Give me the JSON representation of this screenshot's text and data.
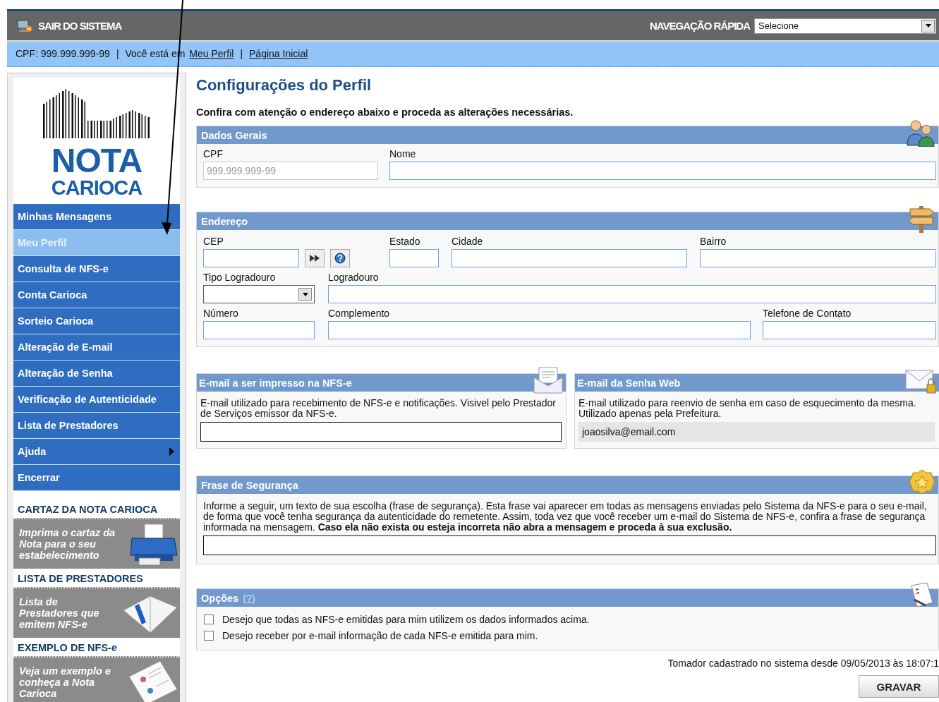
{
  "header": {
    "exit_label": "SAIR DO SISTEMA",
    "quick_nav_label": "NAVEGAÇÃO RÁPIDA",
    "quick_nav_value": "Selecione"
  },
  "breadcrumb": {
    "cpf": "CPF: 999.999.999-99",
    "separator": "|",
    "location_label": "Você está em",
    "links": [
      "Meu Perfil",
      "Página Inicial"
    ]
  },
  "sidebar": {
    "logo": {
      "top": "NOTA",
      "bottom": "CARIOCA"
    },
    "menu": [
      {
        "label": "Minhas Mensagens",
        "selected": false,
        "has_submenu": false
      },
      {
        "label": "Meu Perfil",
        "selected": true,
        "has_submenu": false
      },
      {
        "label": "Consulta de NFS-e",
        "selected": false,
        "has_submenu": false
      },
      {
        "label": "Conta Carioca",
        "selected": false,
        "has_submenu": false
      },
      {
        "label": "Sorteio Carioca",
        "selected": false,
        "has_submenu": false
      },
      {
        "label": "Alteração de E-mail",
        "selected": false,
        "has_submenu": false
      },
      {
        "label": "Alteração de Senha",
        "selected": false,
        "has_submenu": false
      },
      {
        "label": "Verificação de Autenticidade",
        "selected": false,
        "has_submenu": false
      },
      {
        "label": "Lista de Prestadores",
        "selected": false,
        "has_submenu": false
      },
      {
        "label": "Ajuda",
        "selected": false,
        "has_submenu": true
      },
      {
        "label": "Encerrar",
        "selected": false,
        "has_submenu": false
      }
    ],
    "promos": [
      {
        "kind": "printer",
        "title": "CARTAZ DA NOTA CARIOCA",
        "text": "Imprima o cartaz da Nota para o seu estabelecimento"
      },
      {
        "kind": "book",
        "title": "LISTA DE PRESTADORES",
        "text": "Lista de Prestadores que emitem NFS-e"
      },
      {
        "kind": "document",
        "title": "EXEMPLO DE NFS-e",
        "text": "Veja um exemplo e conheça a Nota Carioca"
      }
    ]
  },
  "main": {
    "title": "Configurações do Perfil",
    "intro": "Confira com atenção o endereço abaixo e proceda as alterações necessárias.",
    "dados_gerais": {
      "title": "Dados Gerais",
      "fields": [
        {
          "label": "CPF",
          "value": "999.999.999-99",
          "disabled": true
        },
        {
          "label": "Nome",
          "disabled": false
        }
      ]
    },
    "endereco": {
      "title": "Endereço",
      "rows": [
        [
          {
            "label": "CEP",
            "kind": "cep"
          },
          {
            "label": "Estado",
            "kind": "text"
          },
          {
            "label": "Cidade",
            "kind": "text"
          },
          {
            "label": "Bairro",
            "kind": "text"
          }
        ],
        [
          {
            "label": "Tipo Logradouro",
            "kind": "select"
          },
          {
            "label": "Logradouro",
            "kind": "text"
          }
        ],
        [
          {
            "label": "Número",
            "kind": "text"
          },
          {
            "label": "Complemento",
            "kind": "text"
          },
          {
            "label": "Telefone de Contato",
            "kind": "text"
          }
        ]
      ]
    },
    "emails": [
      {
        "kind": "print",
        "title": "E-mail a ser impresso na NFS-e",
        "description": "E-mail utilizado para recebimento de NFS-e e notificações. Visivel pelo Prestador de Serviços emissor da NFS-e.",
        "editable": true
      },
      {
        "kind": "password",
        "title": "E-mail da Senha Web",
        "description": "E-mail utilizado para reenvio de senha em caso de esquecimento da mesma. Utilizado apenas pela Prefeitura.",
        "value": "joaosilva@email.com",
        "editable": false
      }
    ],
    "frase": {
      "title": "Frase de Segurança",
      "text": "Informe a seguir, um texto de sua escolha (frase de segurança). Esta frase vai aparecer em todas as mensagens enviadas pelo Sistema da NFS-e para o seu e-mail, de forma que você tenha segurança da autenticidade do remetente. Assim, toda vez que você receber um e-mail do Sistema de NFS-e, confira a frase de segurança informada na mensagem. **Caso ela não exista ou esteja incorreta não abra a mensagem e proceda à sua exclusão.**"
    },
    "opcoes": {
      "title": "Opções",
      "help": "(?)",
      "options": [
        {
          "label": "Desejo que todas as NFS-e emitidas para mim utilizem os dados informados acima.",
          "checked": false
        },
        {
          "label": "Desejo receber por e-mail informação de cada NFS-e emitida para mim.",
          "checked": false
        }
      ]
    },
    "footer_note": "Tomador cadastrado no sistema desde 09/05/2013 às 18:07:1",
    "save_button": "GRAVAR"
  }
}
